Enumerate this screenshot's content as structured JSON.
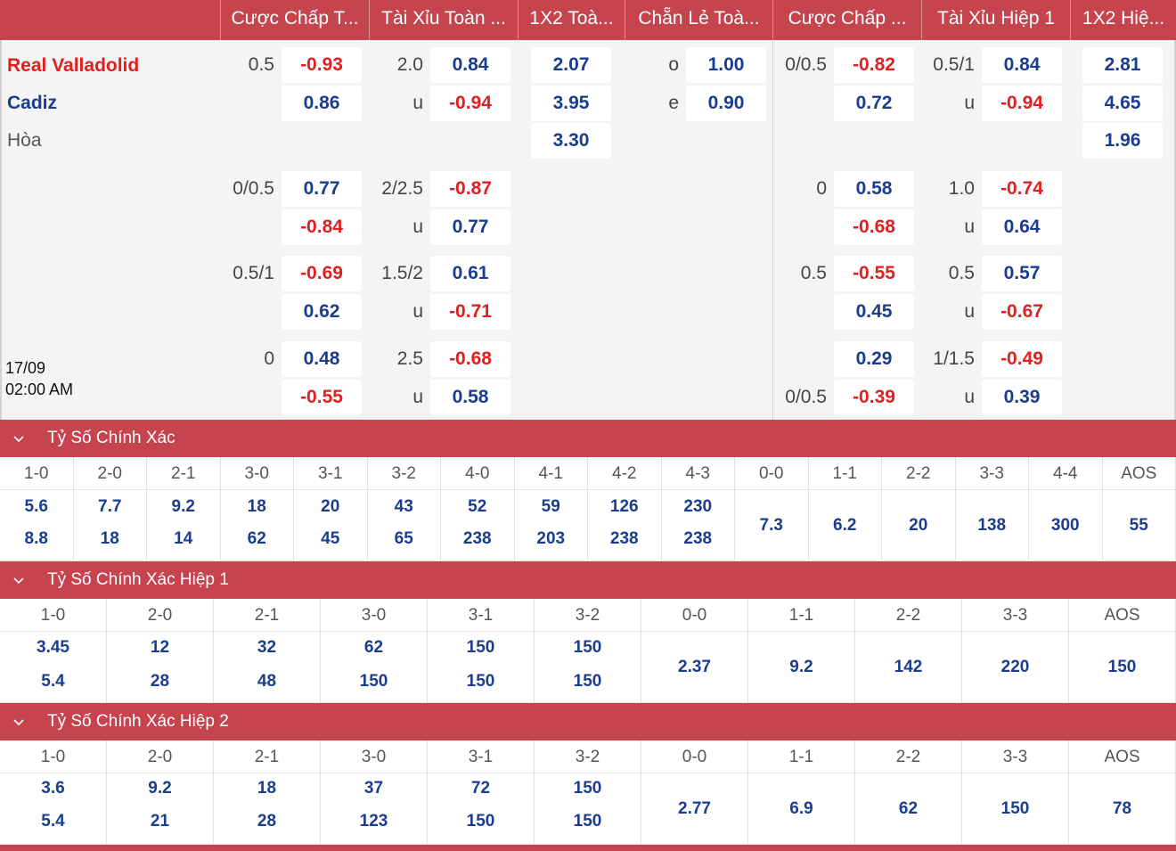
{
  "header": {
    "columns": [
      "Cược Chấp T...",
      "Tài Xỉu Toàn ...",
      "1X2 Toà...",
      "Chẵn Lẻ Toà...",
      "Cược Chấp ...",
      "Tài Xỉu Hiệp 1",
      "1X2 Hiệ..."
    ]
  },
  "match": {
    "home": "Real Valladolid",
    "away": "Cadiz",
    "draw": "Hòa",
    "date": "17/09",
    "time": "02:00 AM"
  },
  "odds": {
    "row1": {
      "ah_line": "0.5",
      "ah_home": "-0.93",
      "ah_away": "0.86",
      "ou_line": "2.0",
      "ou_over": "0.84",
      "ou_under_label": "u",
      "ou_under": "-0.94",
      "x12_home": "2.07",
      "x12_away": "3.95",
      "x12_draw": "3.30",
      "oe_odd_label": "o",
      "oe_odd": "1.00",
      "oe_even_label": "e",
      "oe_even": "0.90",
      "h1_ah_line": "0/0.5",
      "h1_ah_home": "-0.82",
      "h1_ah_away": "0.72",
      "h1_ou_line": "0.5/1",
      "h1_ou_over": "0.84",
      "h1_ou_under_label": "u",
      "h1_ou_under": "-0.94",
      "h1_x12_home": "2.81",
      "h1_x12_away": "4.65",
      "h1_x12_draw": "1.96"
    },
    "row2": {
      "ah_line": "0/0.5",
      "ah_home": "0.77",
      "ah_away": "-0.84",
      "ou_line": "2/2.5",
      "ou_over": "-0.87",
      "ou_under_label": "u",
      "ou_under": "0.77",
      "h1_ah_line": "0",
      "h1_ah_home": "0.58",
      "h1_ah_away": "-0.68",
      "h1_ou_line": "1.0",
      "h1_ou_over": "-0.74",
      "h1_ou_under_label": "u",
      "h1_ou_under": "0.64"
    },
    "row3": {
      "ah_line": "0.5/1",
      "ah_home": "-0.69",
      "ah_away": "0.62",
      "ou_line": "1.5/2",
      "ou_over": "0.61",
      "ou_under_label": "u",
      "ou_under": "-0.71",
      "h1_ah_line": "0.5",
      "h1_ah_home": "-0.55",
      "h1_ah_away": "0.45",
      "h1_ou_line": "0.5",
      "h1_ou_over": "0.57",
      "h1_ou_under_label": "u",
      "h1_ou_under": "-0.67"
    },
    "row4": {
      "ah_line": "0",
      "ah_home": "0.48",
      "ah_away": "-0.55",
      "ou_line": "2.5",
      "ou_over": "-0.68",
      "ou_under_label": "u",
      "ou_under": "0.58",
      "h1_ah_home": "0.29",
      "h1_ah_away_line": "0/0.5",
      "h1_ah_away": "-0.39",
      "h1_ou_line": "1/1.5",
      "h1_ou_over": "-0.49",
      "h1_ou_under_label": "u",
      "h1_ou_under": "0.39"
    }
  },
  "sections": [
    {
      "title": "Tỷ Số Chính Xác",
      "labels": [
        "1-0",
        "2-0",
        "2-1",
        "3-0",
        "3-1",
        "3-2",
        "4-0",
        "4-1",
        "4-2",
        "4-3",
        "0-0",
        "1-1",
        "2-2",
        "3-3",
        "4-4",
        "AOS"
      ],
      "home": [
        "5.6",
        "7.7",
        "9.2",
        "18",
        "20",
        "43",
        "52",
        "59",
        "126",
        "230"
      ],
      "away": [
        "8.8",
        "18",
        "14",
        "62",
        "45",
        "65",
        "238",
        "203",
        "238",
        "238"
      ],
      "single": [
        "7.3",
        "6.2",
        "20",
        "138",
        "300",
        "55"
      ]
    },
    {
      "title": "Tỷ Số Chính Xác Hiệp 1",
      "labels": [
        "1-0",
        "2-0",
        "2-1",
        "3-0",
        "3-1",
        "3-2",
        "0-0",
        "1-1",
        "2-2",
        "3-3",
        "AOS"
      ],
      "home": [
        "3.45",
        "12",
        "32",
        "62",
        "150",
        "150"
      ],
      "away": [
        "5.4",
        "28",
        "48",
        "150",
        "150",
        "150"
      ],
      "single": [
        "2.37",
        "9.2",
        "142",
        "220",
        "150"
      ]
    },
    {
      "title": "Tỷ Số Chính Xác Hiệp 2",
      "labels": [
        "1-0",
        "2-0",
        "2-1",
        "3-0",
        "3-1",
        "3-2",
        "0-0",
        "1-1",
        "2-2",
        "3-3",
        "AOS"
      ],
      "home": [
        "3.6",
        "9.2",
        "18",
        "37",
        "72",
        "150"
      ],
      "away": [
        "5.4",
        "21",
        "28",
        "123",
        "150",
        "150"
      ],
      "single": [
        "2.77",
        "6.9",
        "62",
        "150",
        "78"
      ]
    }
  ],
  "colors": {
    "header_bg": "#c6444e",
    "positive": "#1a3d8f",
    "negative": "#e02020",
    "panel_bg": "#f4f4f4"
  }
}
